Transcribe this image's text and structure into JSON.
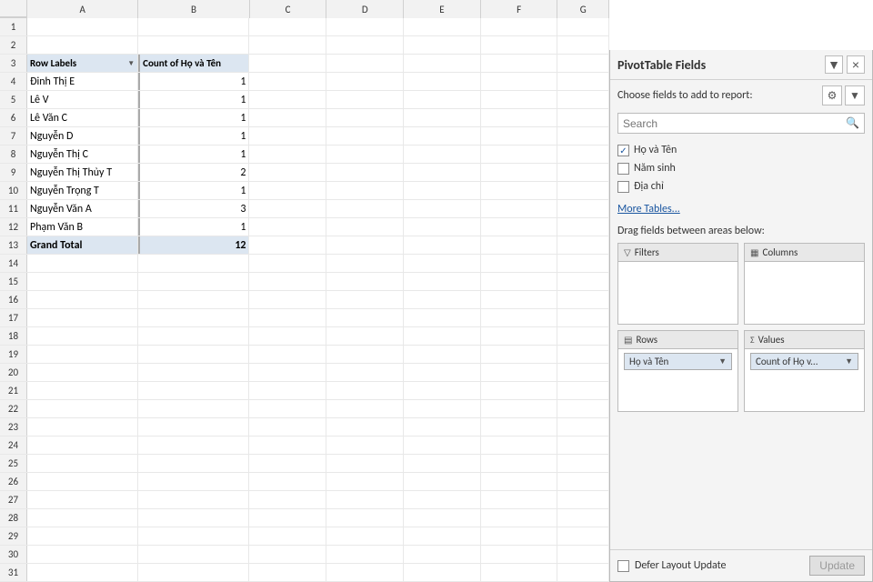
{
  "spreadsheet": {
    "columns": [
      "A",
      "B",
      "C",
      "D",
      "E",
      "F",
      "G"
    ],
    "col3label": "C",
    "col4label": "D",
    "col5label": "E",
    "col6label": "F",
    "col7label": "G"
  },
  "pivot_table": {
    "header": {
      "col_a": "Row Labels",
      "col_b": "Count of Họ và Tên"
    },
    "rows": [
      {
        "label": "Đinh Thị E",
        "value": "1"
      },
      {
        "label": "Lê V",
        "value": "1"
      },
      {
        "label": "Lê Văn C",
        "value": "1"
      },
      {
        "label": "Nguyễn D",
        "value": "1"
      },
      {
        "label": "Nguyễn Thị C",
        "value": "1"
      },
      {
        "label": "Nguyễn Thị Thủy T",
        "value": "2"
      },
      {
        "label": "Nguyễn Trọng T",
        "value": "1"
      },
      {
        "label": "Nguyễn Văn A",
        "value": "3"
      },
      {
        "label": "Phạm Văn B",
        "value": "1"
      }
    ],
    "grand_total_label": "Grand Total",
    "grand_total_value": "12"
  },
  "row_numbers": [
    "1",
    "2",
    "3",
    "4",
    "5",
    "6",
    "7",
    "8",
    "9",
    "10",
    "11",
    "12",
    "13",
    "14",
    "15",
    "16",
    "17",
    "18",
    "19",
    "20",
    "21",
    "22",
    "23",
    "24",
    "25",
    "26",
    "27",
    "28",
    "29",
    "30",
    "31"
  ],
  "panel": {
    "title": "PivotTable Fields",
    "choose_text": "Choose fields to add to report:",
    "search_placeholder": "Search",
    "fields": [
      {
        "label": "Họ và Tên",
        "checked": true
      },
      {
        "label": "Năm sinh",
        "checked": false
      },
      {
        "label": "Địa chỉ",
        "checked": false
      }
    ],
    "more_tables": "More Tables...",
    "drag_label": "Drag fields between areas below:",
    "areas": {
      "filters_label": "Filters",
      "columns_label": "Columns",
      "rows_label": "Rows",
      "values_label": "Values",
      "rows_item": "Họ và Tên",
      "values_item": "Count of Họ v..."
    },
    "defer_label": "Defer Layout Update",
    "update_label": "Update",
    "close_label": "×",
    "settings_icon": "⚙",
    "dropdown_icon": "▼"
  }
}
